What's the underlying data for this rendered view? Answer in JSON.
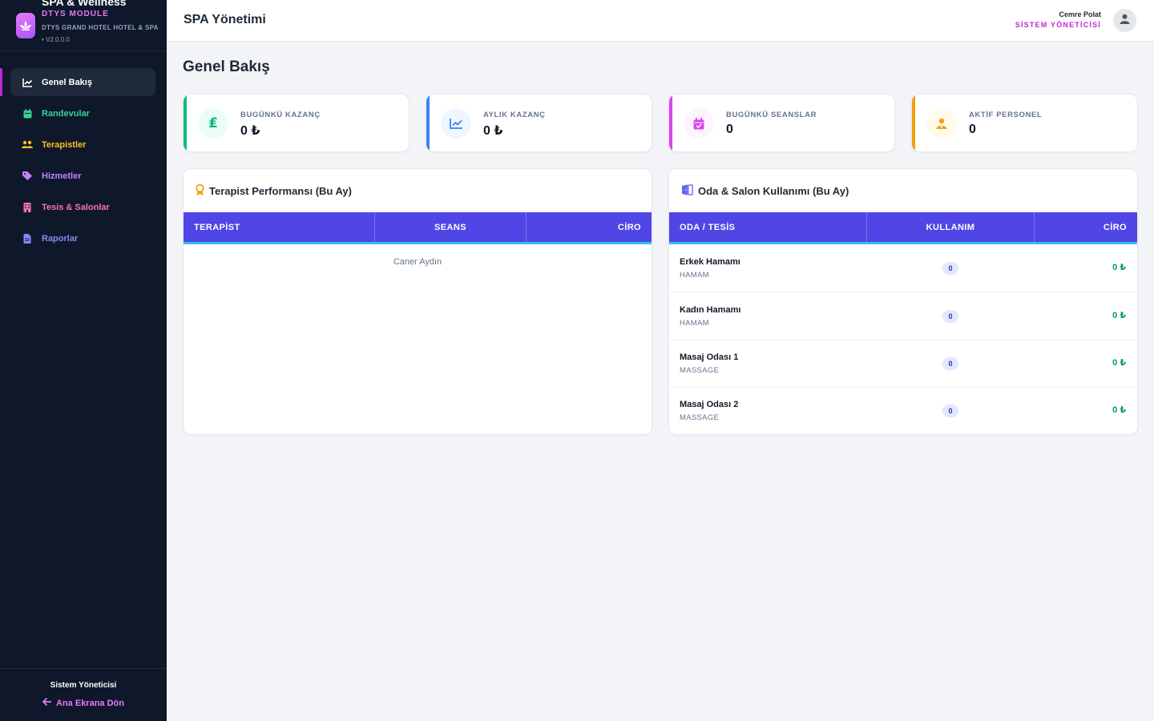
{
  "sidebar": {
    "brand": {
      "title": "SPA & Wellness",
      "module": "DTYS MODULE",
      "hotel": "DTYS GRAND HOTEL HOTEL & SPA",
      "version": "• V2.0.0.0"
    },
    "items": [
      {
        "label": "Genel Bakış",
        "icon": "chart-line-icon",
        "color": "#ffffff"
      },
      {
        "label": "Randevular",
        "icon": "calendar-icon",
        "color": "#34d399"
      },
      {
        "label": "Terapistler",
        "icon": "users-icon",
        "color": "#fbbf24"
      },
      {
        "label": "Hizmetler",
        "icon": "tag-icon",
        "color": "#c084fc"
      },
      {
        "label": "Tesis & Salonlar",
        "icon": "building-icon",
        "color": "#f472b6"
      },
      {
        "label": "Raporlar",
        "icon": "file-icon",
        "color": "#818cf8"
      }
    ],
    "footer": {
      "role": "Sistem Yöneticisi",
      "back_label": "Ana Ekrana Dön"
    }
  },
  "header": {
    "title": "SPA Yönetimi",
    "user_name": "Cemre Polat",
    "user_role": "SİSTEM YÖNETİCİSİ"
  },
  "main": {
    "page_title": "Genel Bakış",
    "stats": [
      {
        "label": "BUGÜNKÜ KAZANÇ",
        "value": "0 ₺",
        "icon": "lira-icon",
        "color": "#10b981",
        "bg": "#ecfdf5"
      },
      {
        "label": "AYLIK KAZANÇ",
        "value": "0 ₺",
        "icon": "chart-line-icon",
        "color": "#3b82f6",
        "bg": "#eff6ff"
      },
      {
        "label": "BUGÜNKÜ SEANSLAR",
        "value": "0",
        "icon": "calendar-check-icon",
        "color": "#d946ef",
        "bg": "#fdf4ff"
      },
      {
        "label": "AKTİF PERSONEL",
        "value": "0",
        "icon": "user-tie-icon",
        "color": "#f59e0b",
        "bg": "#fffbeb"
      }
    ],
    "therapist_panel": {
      "title": "Terapist Performansı (Bu Ay)",
      "columns": [
        "TERAPİST",
        "SEANS",
        "CİRO"
      ],
      "note": "Caner Aydın"
    },
    "room_panel": {
      "title": "Oda & Salon Kullanımı (Bu Ay)",
      "columns": [
        "ODA / TESİS",
        "KULLANIM",
        "CİRO"
      ],
      "rows": [
        {
          "name": "Erkek Hamamı",
          "type": "HAMAM",
          "usage": "0",
          "revenue": "0 ₺"
        },
        {
          "name": "Kadın Hamamı",
          "type": "HAMAM",
          "usage": "0",
          "revenue": "0 ₺"
        },
        {
          "name": "Masaj Odası 1",
          "type": "MASSAGE",
          "usage": "0",
          "revenue": "0 ₺"
        },
        {
          "name": "Masaj Odası 2",
          "type": "MASSAGE",
          "usage": "0",
          "revenue": "0 ₺"
        }
      ]
    }
  }
}
